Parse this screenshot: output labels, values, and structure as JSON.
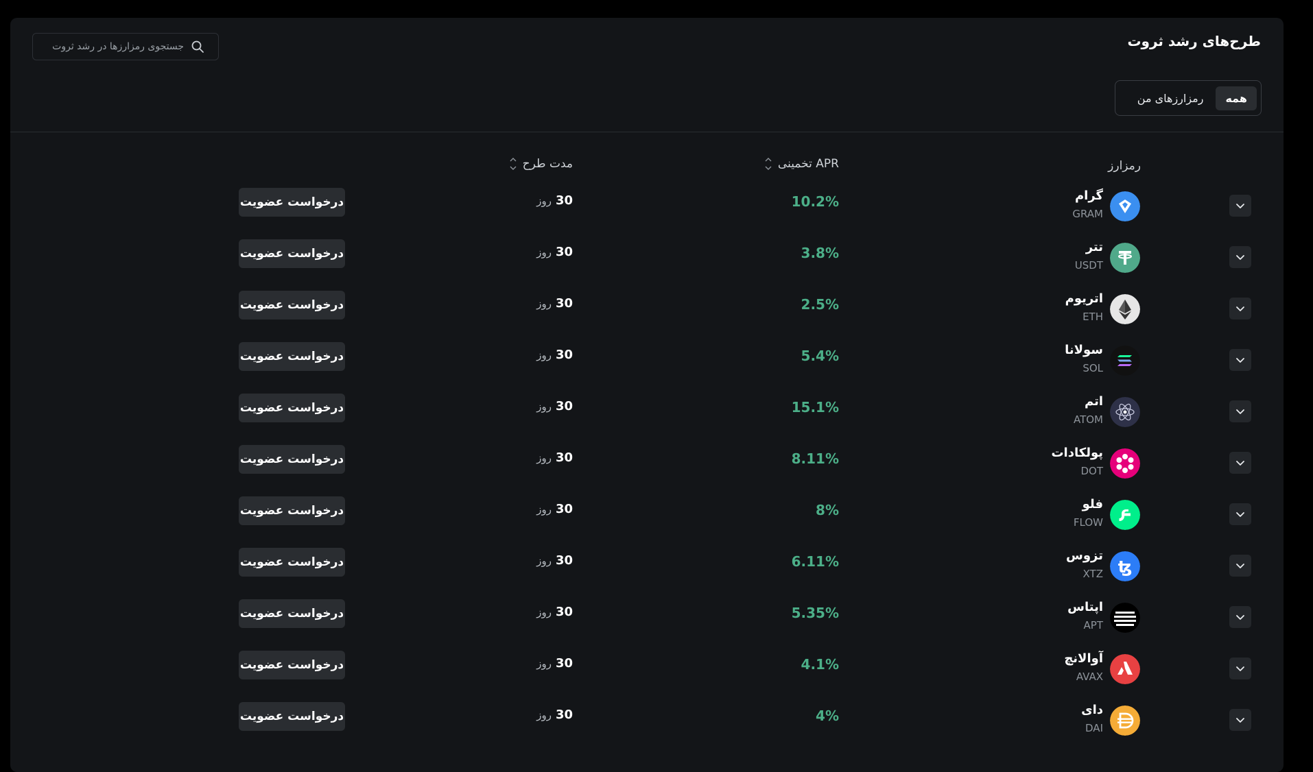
{
  "header": {
    "title": "طرح‌های رشد ثروت",
    "search_placeholder": "جستجوی رمزارزها در رشد ثروت"
  },
  "tabs": [
    {
      "label": "همه",
      "active": true
    },
    {
      "label": "رمزارزهای من",
      "active": false
    }
  ],
  "table": {
    "columns": {
      "asset": "رمزارز",
      "apr": "APR تخمینی",
      "duration": "مدت طرح"
    },
    "join_label": "درخواست عضویت",
    "duration_unit": "روز",
    "rows": [
      {
        "name": "گرام",
        "symbol": "GRAM",
        "apr": "10.2%",
        "duration": "30",
        "color": "#3b8ff0",
        "icon": "gram-icon"
      },
      {
        "name": "تتر",
        "symbol": "USDT",
        "apr": "3.8%",
        "duration": "30",
        "color": "#50a98a",
        "icon": "tether-icon"
      },
      {
        "name": "اتریوم",
        "symbol": "ETH",
        "apr": "2.5%",
        "duration": "30",
        "color": "#e6e6e6",
        "icon": "ethereum-icon"
      },
      {
        "name": "سولانا",
        "symbol": "SOL",
        "apr": "5.4%",
        "duration": "30",
        "color": "#111111",
        "icon": "solana-icon"
      },
      {
        "name": "اتم",
        "symbol": "ATOM",
        "apr": "15.1%",
        "duration": "30",
        "color": "#2e3148",
        "icon": "cosmos-icon"
      },
      {
        "name": "پولکادات",
        "symbol": "DOT",
        "apr": "8.11%",
        "duration": "30",
        "color": "#e6007a",
        "icon": "polkadot-icon"
      },
      {
        "name": "فلو",
        "symbol": "FLOW",
        "apr": "8%",
        "duration": "30",
        "color": "#00ef8b",
        "icon": "flow-icon"
      },
      {
        "name": "تزوس",
        "symbol": "XTZ",
        "apr": "6.11%",
        "duration": "30",
        "color": "#2c7df7",
        "icon": "tezos-icon"
      },
      {
        "name": "اپتاس",
        "symbol": "APT",
        "apr": "5.35%",
        "duration": "30",
        "color": "#ffffff",
        "icon": "aptos-icon"
      },
      {
        "name": "آوالانچ",
        "symbol": "AVAX",
        "apr": "4.1%",
        "duration": "30",
        "color": "#e84142",
        "icon": "avalanche-icon"
      },
      {
        "name": "دای",
        "symbol": "DAI",
        "apr": "4%",
        "duration": "30",
        "color": "#f5ac37",
        "icon": "dai-icon"
      }
    ]
  }
}
